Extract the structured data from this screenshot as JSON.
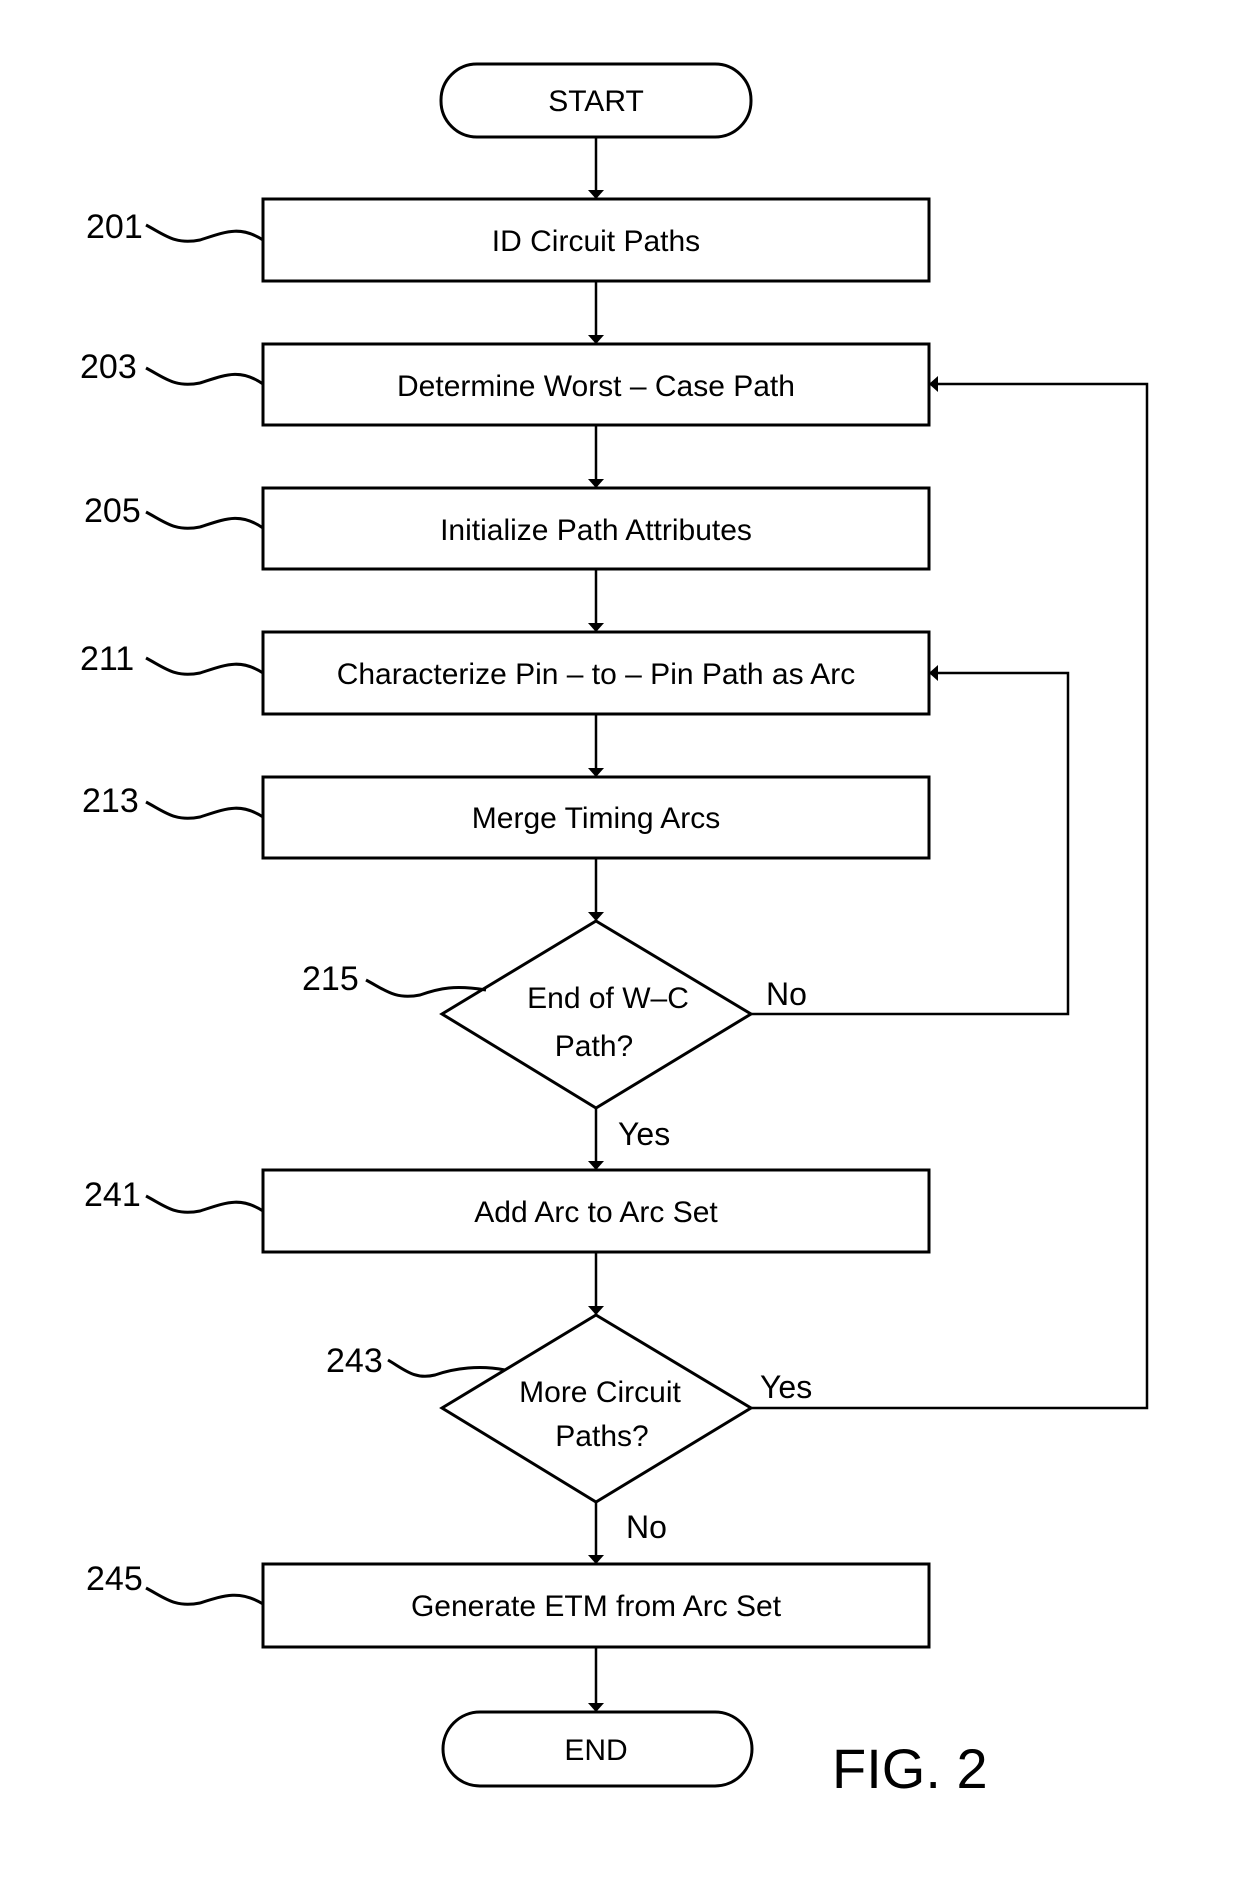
{
  "figure_label": "FIG. 2",
  "terminals": {
    "start": "START",
    "end": "END"
  },
  "steps": [
    {
      "ref": "201",
      "label": "ID Circuit Paths"
    },
    {
      "ref": "203",
      "label": "Determine Worst – Case Path"
    },
    {
      "ref": "205",
      "label": "Initialize Path Attributes"
    },
    {
      "ref": "211",
      "label": "Characterize Pin – to – Pin Path as Arc"
    },
    {
      "ref": "213",
      "label": "Merge Timing Arcs"
    },
    {
      "ref": "241",
      "label": "Add Arc to Arc Set"
    },
    {
      "ref": "245",
      "label": "Generate ETM from Arc Set"
    }
  ],
  "decisions": [
    {
      "ref": "215",
      "line1": "End of W–C",
      "line2": "Path?",
      "yes": "Yes",
      "no": "No"
    },
    {
      "ref": "243",
      "line1": "More Circuit",
      "line2": "Paths?",
      "yes": "Yes",
      "no": "No"
    }
  ]
}
